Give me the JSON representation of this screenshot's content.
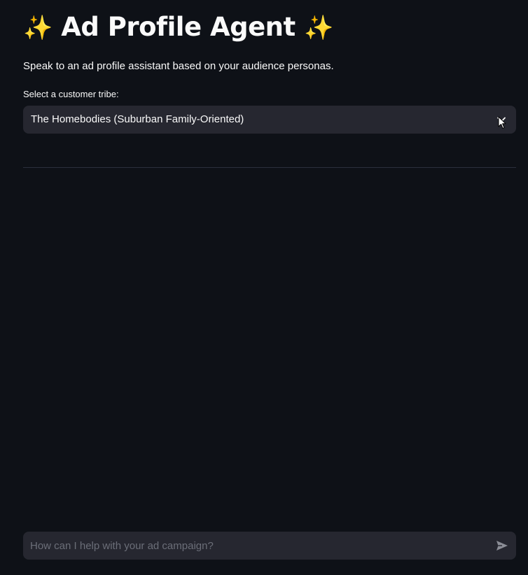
{
  "header": {
    "title": "Ad Profile Agent",
    "sparkle_left": "✨",
    "sparkle_right": "✨"
  },
  "intro": {
    "subtitle": "Speak to an ad profile assistant based on your audience personas."
  },
  "tribe_select": {
    "label": "Select a customer tribe:",
    "selected": "The Homebodies (Suburban Family-Oriented)"
  },
  "chat": {
    "placeholder": "How can I help with your ad campaign?",
    "value": ""
  },
  "colors": {
    "background": "#0e1117",
    "surface": "#262730",
    "text": "#fafafa",
    "placeholder": "#6b6e78",
    "sparkle": "#f5c542"
  },
  "icons": {
    "select_arrow": "chevron-down-icon",
    "send": "send-icon",
    "sparkles": "sparkles-icon"
  }
}
